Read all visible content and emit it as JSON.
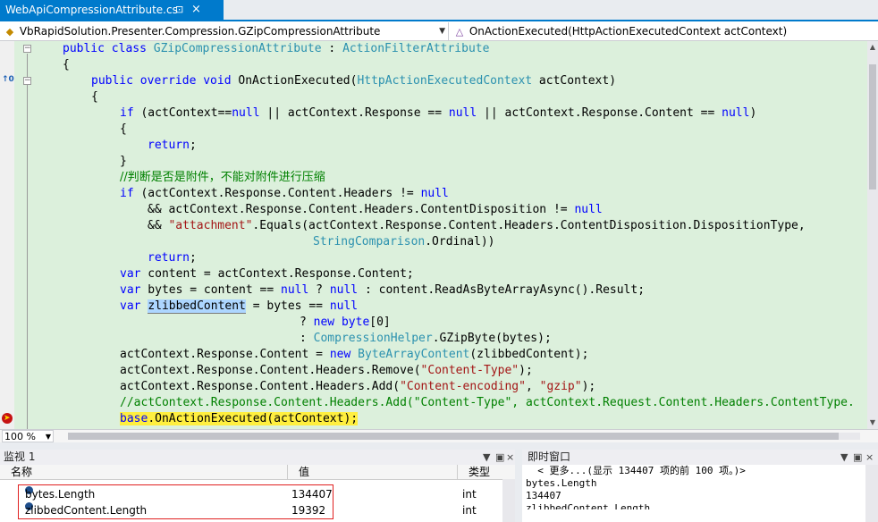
{
  "tab": {
    "title": "WebApiCompressionAttribute.cs",
    "pin": "⊡",
    "close": "×"
  },
  "nav": {
    "left": "VbRapidSolution.Presenter.Compression.GZipCompressionAttribute",
    "right": "OnActionExecuted(HttpActionExecutedContext actContext)"
  },
  "code": {
    "l1_kw": "public class ",
    "l1_ty": "GZipCompressionAttribute",
    "l1_mid": " : ",
    "l1_ty2": "ActionFilterAttribute",
    "l2": "{",
    "l3_kw": "public override void ",
    "l3_name": "OnActionExecuted(",
    "l3_ty": "HttpActionExecutedContext",
    "l3_rest": " actContext)",
    "l4": "{",
    "l5_kw": "if",
    "l5_a": " (actContext==",
    "l5_n1": "null",
    "l5_b": " || actContext.Response == ",
    "l5_n2": "null",
    "l5_c": " || actContext.Response.Content == ",
    "l5_n3": "null",
    "l5_d": ")",
    "l6": "{",
    "l7_kw": "return",
    "l7_rest": ";",
    "l8": "}",
    "l9": "//判断是否是附件，不能对附件进行压缩",
    "l10_kw": "if",
    "l10_a": " (actContext.Response.Content.Headers != ",
    "l10_n": "null",
    "l11_a": "&& actContext.Response.Content.Headers.ContentDisposition != ",
    "l11_n": "null",
    "l12_a": "&& ",
    "l12_s": "\"attachment\"",
    "l12_b": ".Equals(actContext.Response.Content.Headers.ContentDisposition.DispositionType,",
    "l13_ty": "StringComparison",
    "l13_rest": ".Ordinal))",
    "l14_kw": "return",
    "l14_rest": ";",
    "l15_kw": "var",
    "l15_rest": " content = actContext.Response.Content;",
    "l16_kw": "var",
    "l16_a": " bytes = content == ",
    "l16_n1": "null",
    "l16_b": " ? ",
    "l16_n2": "null",
    "l16_c": " : content.ReadAsByteArrayAsync().Result;",
    "l17_kw": "var",
    "l17_sp": " ",
    "l17_sel": "zlibbedContent",
    "l17_a": " = bytes == ",
    "l17_n": "null",
    "l18_a": "? ",
    "l18_kw": "new byte",
    "l18_b": "[0]",
    "l19_a": ": ",
    "l19_ty": "CompressionHelper",
    "l19_b": ".GZipByte(bytes);",
    "l20_a": "actContext.Response.Content = ",
    "l20_kw": "new ",
    "l20_ty": "ByteArrayContent",
    "l20_b": "(zlibbedContent);",
    "l21_a": "actContext.Response.Content.Headers.Remove(",
    "l21_s": "\"Content-Type\"",
    "l21_b": ");",
    "l22_a": "actContext.Response.Content.Headers.Add(",
    "l22_s1": "\"Content-encoding\"",
    "l22_b": ", ",
    "l22_s2": "\"gzip\"",
    "l22_c": ");",
    "l23": "//actContext.Response.Content.Headers.Add(\"Content-Type\", actContext.Request.Content.Headers.ContentType.",
    "l24_a": "base",
    "l24_b": ".OnActionExecuted(actContext);"
  },
  "zoom": "100 %",
  "watch": {
    "title": "监视 1",
    "col_name": "名称",
    "col_value": "值",
    "col_type": "类型",
    "rows": [
      {
        "name": "bytes.Length",
        "value": "134407",
        "type": "int"
      },
      {
        "name": "zlibbedContent.Length",
        "value": "19392",
        "type": "int"
      }
    ]
  },
  "immediate": {
    "title": "即时窗口",
    "lines": [
      "  < 更多...(显示 134407 项的前 100 项。)>",
      "bytes.Length",
      "134407",
      "zlibbedContent.Length"
    ]
  },
  "colors": {
    "accent": "#007acc",
    "code_bg": "#dcf0dc",
    "keyword": "#0000ff",
    "type": "#2b91af",
    "string": "#a31515",
    "comment": "#008000"
  },
  "icons": [
    "pin-icon",
    "close-icon",
    "class-icon",
    "method-icon",
    "breakpoint-icon",
    "watch-item-icon",
    "dropdown-arrow-icon"
  ]
}
